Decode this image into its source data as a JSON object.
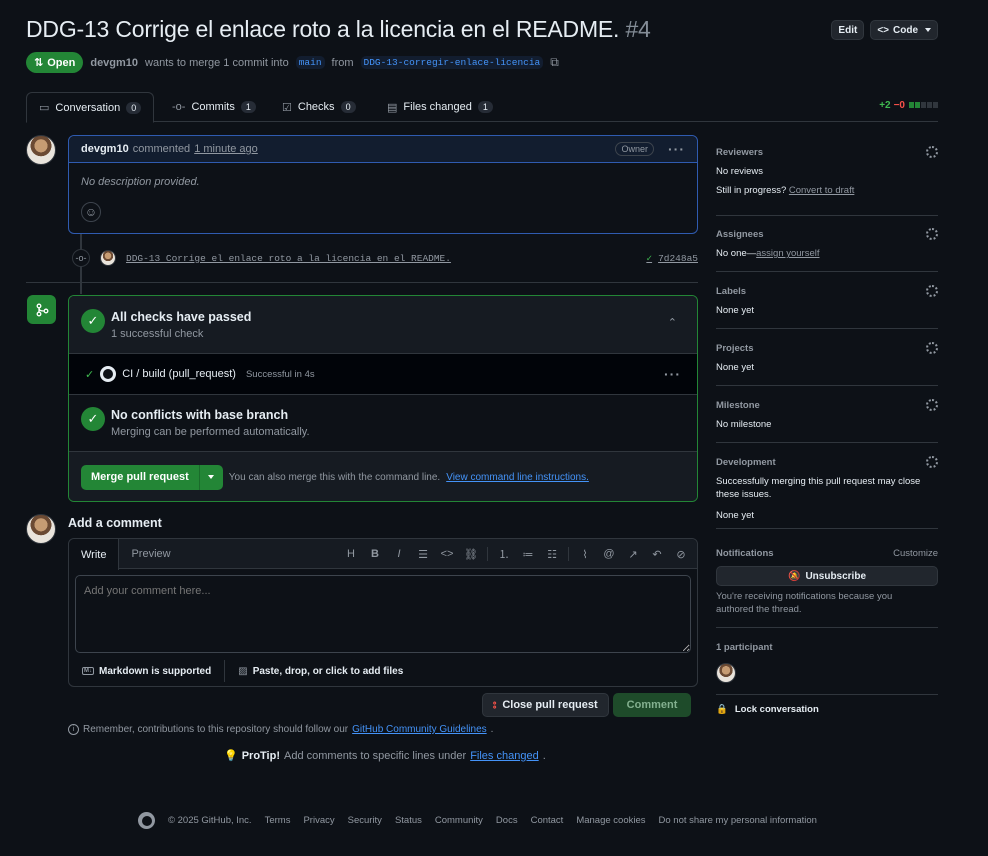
{
  "header": {
    "title": "DDG-13 Corrige el enlace roto a la licencia en el README.",
    "number": "#4",
    "edit_label": "Edit",
    "code_label": "Code"
  },
  "state": {
    "badge": "Open",
    "author": "devgm10",
    "merge_text": "wants to merge 1 commit into",
    "base_branch": "main",
    "from_text": "from",
    "head_branch": "DDG-13-corregir-enlace-licencia"
  },
  "tabs": [
    {
      "label": "Conversation",
      "count": "0"
    },
    {
      "label": "Commits",
      "count": "1"
    },
    {
      "label": "Checks",
      "count": "0"
    },
    {
      "label": "Files changed",
      "count": "1"
    }
  ],
  "diffstat": {
    "additions": "+2",
    "deletions": "−0"
  },
  "comment": {
    "author": "devgm10",
    "action": "commented",
    "time": "1 minute ago",
    "role": "Owner",
    "body": "No description provided."
  },
  "commit": {
    "message": "DDG-13 Corrige el enlace roto a la licencia en el README.",
    "sha": "7d248a5"
  },
  "merge_box": {
    "checks_title": "All checks have passed",
    "checks_sub": "1 successful check",
    "ci_name": "CI / build (pull_request)",
    "ci_status": "Successful in 4s",
    "conflicts_title": "No conflicts with base branch",
    "conflicts_sub": "Merging can be performed automatically.",
    "merge_button": "Merge pull request",
    "cli_text": "You can also merge this with the command line.",
    "cli_link": "View command line instructions."
  },
  "add_comment": {
    "title": "Add a comment",
    "tab_write": "Write",
    "tab_preview": "Preview",
    "placeholder": "Add your comment here...",
    "markdown_note": "Markdown is supported",
    "files_note": "Paste, drop, or click to add files",
    "close_button": "Close pull request",
    "comment_button": "Comment"
  },
  "reminder": {
    "text": "Remember, contributions to this repository should follow our",
    "link": "GitHub Community Guidelines",
    "end": "."
  },
  "protip": {
    "label": "ProTip!",
    "text": "Add comments to specific lines under",
    "link": "Files changed",
    "end": "."
  },
  "sidebar": {
    "reviewers": {
      "title": "Reviewers",
      "value": "No reviews",
      "progress": "Still in progress?",
      "convert": "Convert to draft"
    },
    "assignees": {
      "title": "Assignees",
      "value": "No one—",
      "assign": "assign yourself"
    },
    "labels": {
      "title": "Labels",
      "value": "None yet"
    },
    "projects": {
      "title": "Projects",
      "value": "None yet"
    },
    "milestone": {
      "title": "Milestone",
      "value": "No milestone"
    },
    "development": {
      "title": "Development",
      "desc_line1": "Successfully merging this pull request may close",
      "desc_line2": "these issues.",
      "value": "None yet"
    },
    "notifications": {
      "title": "Notifications",
      "customize": "Customize",
      "button": "Unsubscribe",
      "note_line1": "You're receiving notifications because you",
      "note_line2": "authored the thread."
    },
    "participants": {
      "title": "1 participant"
    },
    "lock": "Lock conversation"
  },
  "footer": {
    "copyright": "© 2025 GitHub, Inc.",
    "links": [
      "Terms",
      "Privacy",
      "Security",
      "Status",
      "Community",
      "Docs",
      "Contact",
      "Manage cookies",
      "Do not share my personal information"
    ]
  },
  "colors": {
    "accent": "#4493f8",
    "success": "#238636",
    "danger": "#f85149",
    "bg": "#0d1117"
  }
}
